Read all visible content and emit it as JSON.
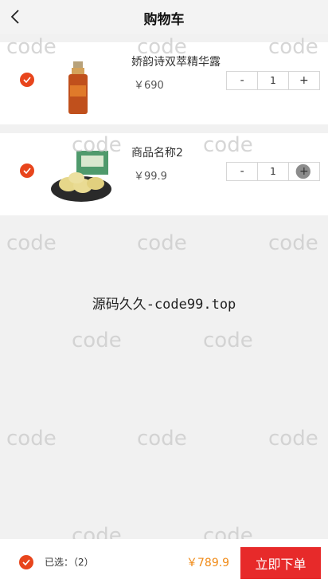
{
  "header": {
    "title": "购物车",
    "back_icon": "chevron-left-icon"
  },
  "cart": {
    "items": [
      {
        "name": "娇韵诗双萃精华露",
        "price": "￥690",
        "qty": "1",
        "minus": "-",
        "plus": "+",
        "checked": true
      },
      {
        "name": "商品名称2",
        "price": "￥99.9",
        "qty": "1",
        "minus": "-",
        "plus": "+",
        "checked": true
      }
    ]
  },
  "center_text": "源码久久-code99.top",
  "watermark": "code",
  "footer": {
    "selected_label": "已选：（2）",
    "total": "￥789.9",
    "order_button": "立即下单"
  },
  "colors": {
    "accent": "#e8451c",
    "order_button": "#e72a2a",
    "total": "#f08a16"
  }
}
